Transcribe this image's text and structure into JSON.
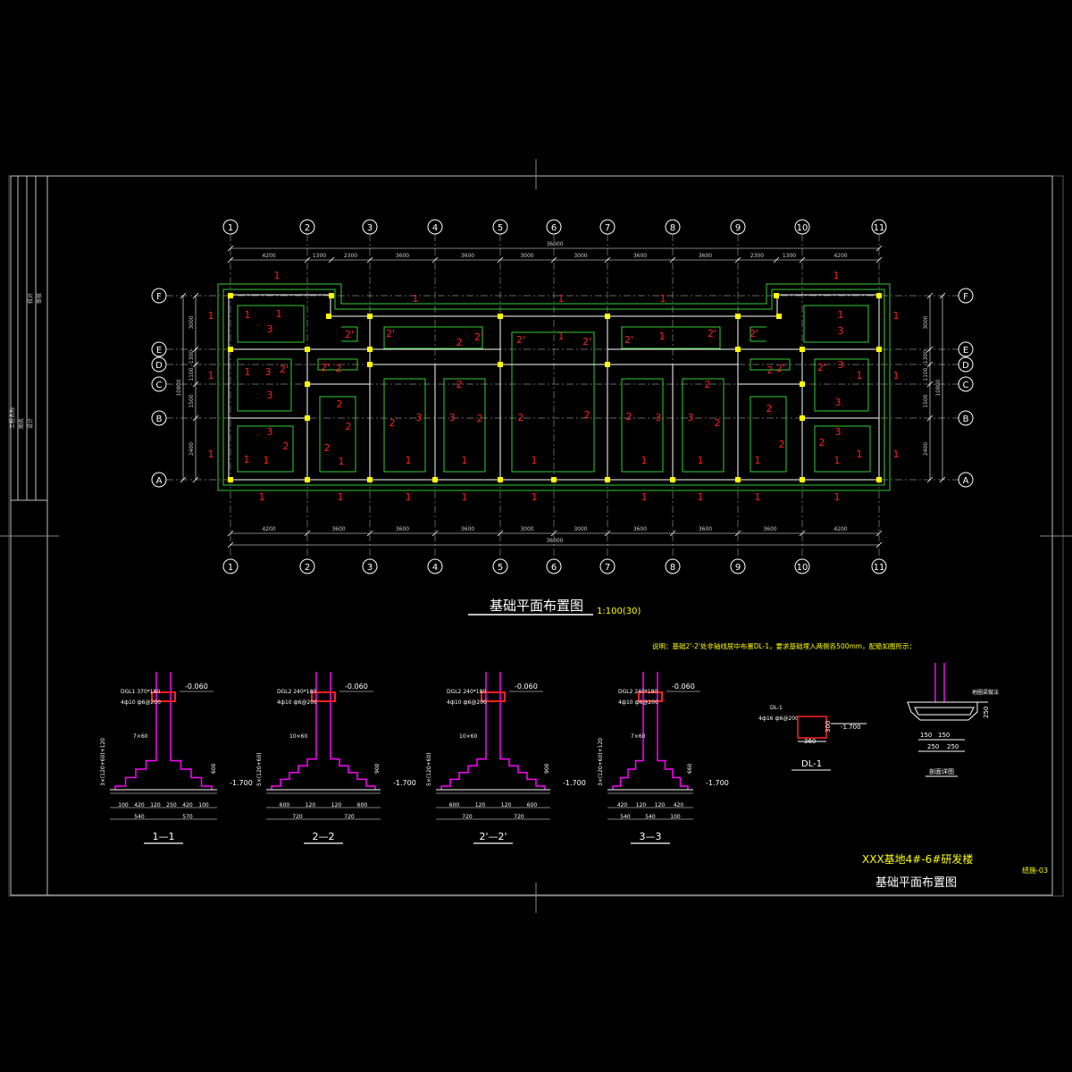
{
  "axes_top": [
    "1",
    "2",
    "3",
    "4",
    "5",
    "6",
    "7",
    "8",
    "9",
    "10",
    "11"
  ],
  "axes_side": [
    "F",
    "E",
    "D",
    "C",
    "B",
    "A"
  ],
  "dims_top": [
    "4200",
    "1300",
    "2300",
    "3600",
    "3600",
    "3000",
    "3000",
    "3600",
    "3600",
    "2300",
    "1300",
    "4200"
  ],
  "dims_bottom": [
    "4200",
    "3600",
    "3600",
    "3600",
    "3000",
    "3000",
    "3600",
    "3600",
    "3600",
    "4200"
  ],
  "total_dim": "36000",
  "dims_left": [
    "3000",
    "1300",
    "1100",
    "1500",
    "2400"
  ],
  "dims_left_total": "10800",
  "dims_right": [
    "3000",
    "1300",
    "1100",
    "1500",
    "2400"
  ],
  "dims_right_total": "10800",
  "plan_title": "基础平面布置图",
  "plan_scale": "1:100(30)",
  "note": "说明：基础2'-2'处非轴线居中布置DL-1，要求基础埋入两侧各500mm，配筋如图所示：",
  "project_name": "XXX基地4#-6#研发楼",
  "sheet_title": "基础平面布置图",
  "drawing_no": "结施-03",
  "titleblock_lines": [
    "工程名称",
    "图名",
    "设计",
    "校对",
    "审核"
  ],
  "sections": [
    {
      "id": "s1",
      "title": "1—1",
      "beam": "DGL1 370*180",
      "rebar": "4ф10 ф6@200",
      "elev_top": "-0.060",
      "elev_bot": "-1.700",
      "step": "7×60",
      "height": "3×(120+60)+120",
      "depth": "600",
      "dims": [
        "100",
        "420",
        "120",
        "250",
        "420",
        "100"
      ],
      "dims2": [
        "540",
        "570"
      ]
    },
    {
      "id": "s2",
      "title": "2—2",
      "beam": "DGL2 240*180",
      "rebar": "4ф10 ф6@200",
      "elev_top": "-0.060",
      "elev_bot": "-1.700",
      "step": "10×60",
      "height": "5×(120+60)",
      "depth": "900",
      "dims": [
        "600",
        "120",
        "120",
        "600"
      ],
      "dims2": [
        "720",
        "720"
      ]
    },
    {
      "id": "s3",
      "title": "2'—2'",
      "beam": "DGL2 240*180",
      "rebar": "4ф10 ф6@200",
      "elev_top": "-0.060",
      "elev_bot": "-1.700",
      "step": "10×60",
      "height": "5×(120+60)",
      "depth": "900",
      "dims": [
        "600",
        "120",
        "120",
        "600"
      ],
      "dims2": [
        "720",
        "720"
      ]
    },
    {
      "id": "s4",
      "title": "3—3",
      "beam": "DGL2 240*180",
      "rebar": "4ф10 ф6@200",
      "elev_top": "-0.060",
      "elev_bot": "-1.700",
      "step": "7×60",
      "height": "3×(120+60)+120",
      "depth": "660",
      "dims": [
        "420",
        "120",
        "120",
        "420"
      ],
      "dims2": [
        "540",
        "540",
        "100"
      ]
    }
  ],
  "dl1": {
    "label": "DL-1",
    "title": "DL-1",
    "rebar": "4ф16 ф6@200",
    "dim_w": "360",
    "dim_h": "300",
    "elev": "-1.700"
  },
  "detail2": {
    "label": "地圈梁做法",
    "title": "剖面详图",
    "dims": [
      "150",
      "150",
      "250",
      "250"
    ],
    "dim_h": "250"
  },
  "colors": {
    "grid": "#ffffff",
    "wall": "#33cc33",
    "label": "#ff2020",
    "section": "#ff00ff",
    "text": "#ffffff",
    "accent": "#ffff00",
    "column": "#ffff00"
  }
}
